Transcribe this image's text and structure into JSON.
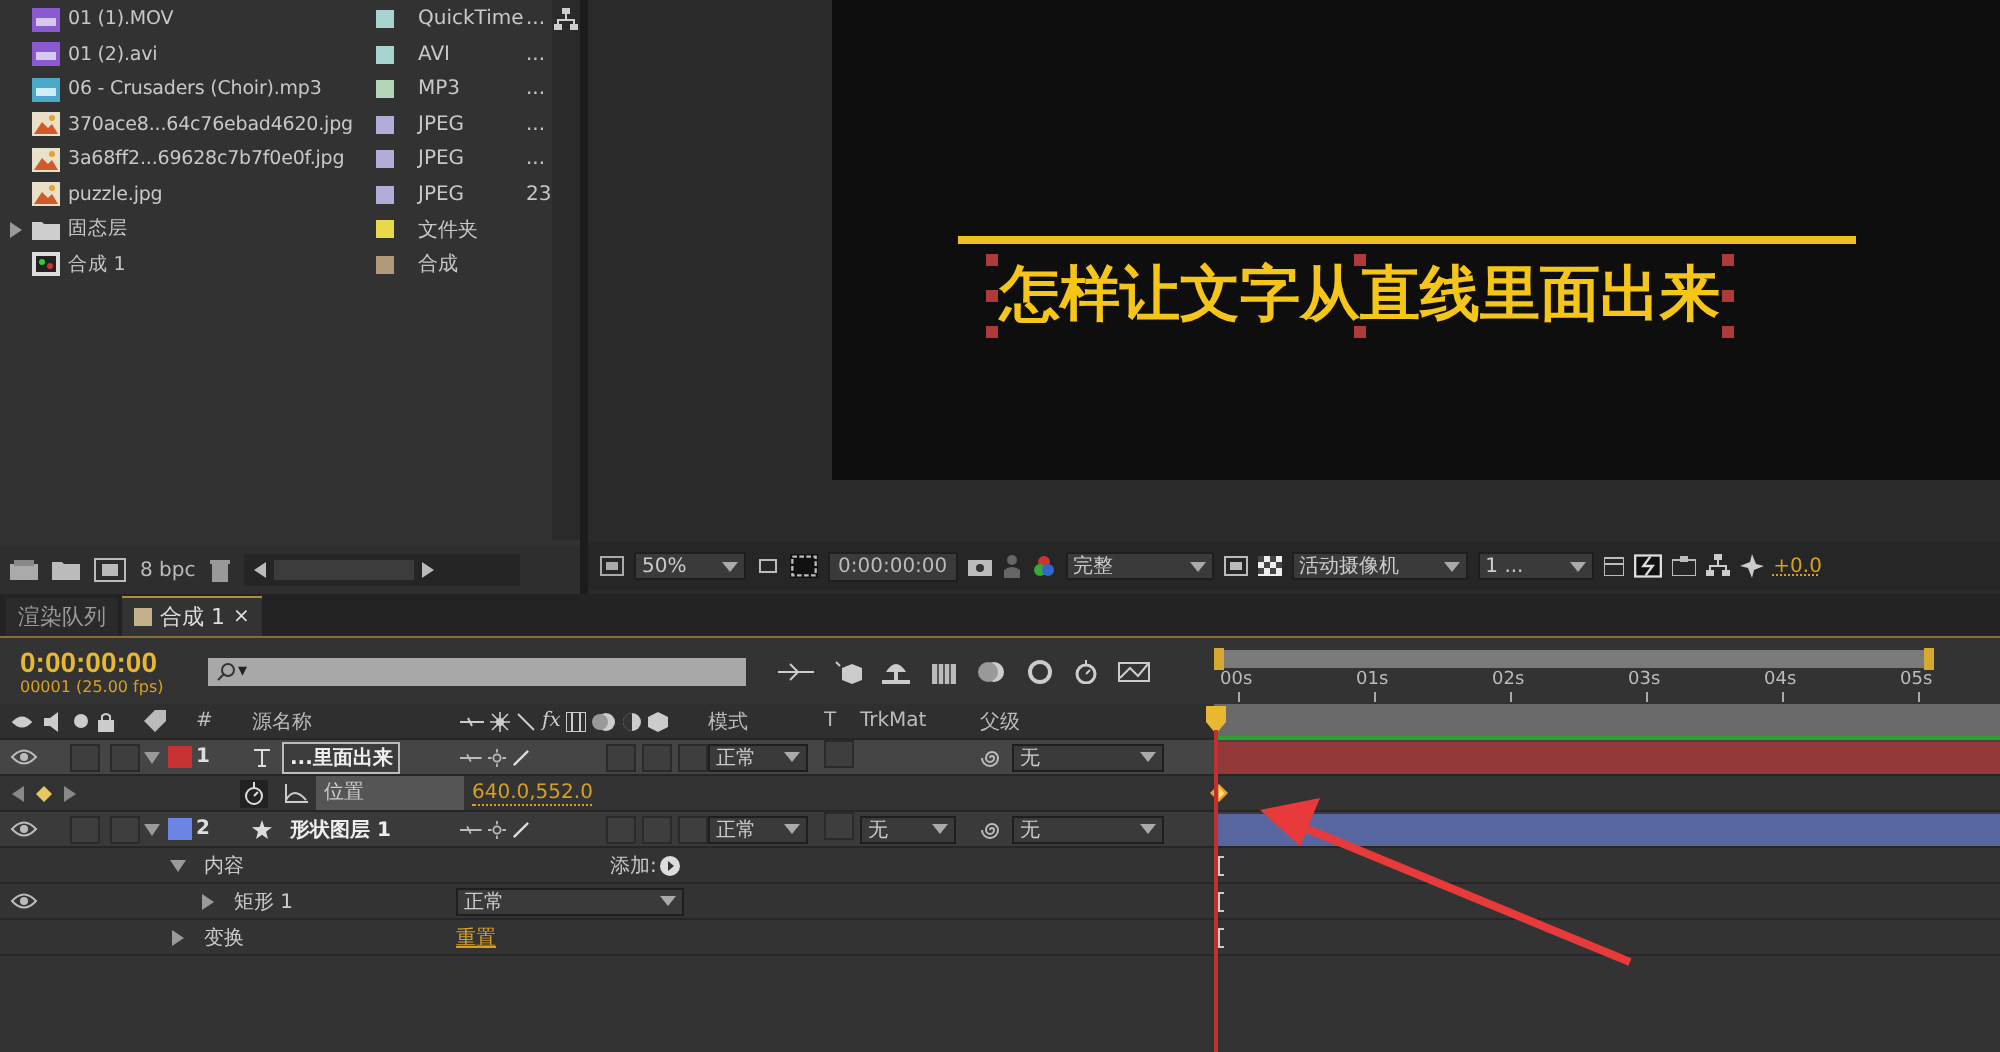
{
  "project": {
    "items": [
      {
        "name": "01 (1).MOV",
        "type": "QuickTime",
        "kind": "video",
        "color": "#a8d4d0",
        "col_4": "..."
      },
      {
        "name": "01 (2).avi",
        "type": "AVI",
        "kind": "video",
        "color": "#a8d4d0",
        "col_4": "..."
      },
      {
        "name": "06 - Crusaders (Choir).mp3",
        "type": "MP3",
        "kind": "audio",
        "color": "#b4d4b8",
        "col_4": "..."
      },
      {
        "name": "370ace8...64c76ebad4620.jpg",
        "type": "JPEG",
        "kind": "image",
        "color": "#b0aed8",
        "col_4": "..."
      },
      {
        "name": "3a68ff2...69628c7b7f0e0f.jpg",
        "type": "JPEG",
        "kind": "image",
        "color": "#b0aed8",
        "col_4": "..."
      },
      {
        "name": "puzzle.jpg",
        "type": "JPEG",
        "kind": "image",
        "color": "#b0aed8",
        "col_4": "23"
      },
      {
        "name": "固态层",
        "type": "文件夹",
        "kind": "folder",
        "color": "#e8d84a",
        "expanded": false
      },
      {
        "name": "合成 1",
        "type": "合成",
        "kind": "comp",
        "color": "#b09a7a"
      }
    ],
    "bit_depth": "8 bpc"
  },
  "viewer": {
    "text": "怎样让文字从直线里面出来",
    "text_selected": true,
    "zoom": "50%",
    "timecode": "0:00:00:00",
    "resolution": "完整",
    "camera": "活动摄像机",
    "views": "1 ...",
    "exposure": "+0.0"
  },
  "tabs": [
    {
      "label": "渲染队列",
      "selected": false
    },
    {
      "label": "合成 1",
      "selected": true,
      "close": "×"
    }
  ],
  "timeline": {
    "current_time": "0:00:00:00",
    "frame_info": "00001 (25.00 fps)",
    "search_prefix": "▾",
    "columns": {
      "effects": "fx",
      "number": "#",
      "source_name": "源名称",
      "mode": "模式",
      "t": "T",
      "trkmat": "TrkMat",
      "parent": "父级"
    },
    "ruler": [
      "00s",
      "01s",
      "02s",
      "03s",
      "04s",
      "05s"
    ],
    "layers": [
      {
        "kind": "text_layer",
        "number": "1",
        "name": "...里面出来",
        "color": "#c83232",
        "selected": true,
        "expanded": true,
        "visible": true,
        "mode": "正常",
        "parent": "无",
        "children": [
          {
            "kind": "property",
            "name": "位置",
            "value": "640.0,552.0",
            "selected": true,
            "keyframe": true
          }
        ]
      },
      {
        "kind": "shape_layer",
        "number": "2",
        "name": "形状图层 1",
        "color": "#6c84e4",
        "selected": false,
        "expanded": true,
        "visible": true,
        "mode": "正常",
        "trkmat": "无",
        "parent": "无",
        "children": [
          {
            "kind": "group",
            "name": "内容",
            "expanded": true,
            "add_label": "添加:",
            "children": [
              {
                "kind": "group",
                "name": "矩形 1",
                "expanded": false,
                "visible": true,
                "blend": "正常"
              }
            ]
          },
          {
            "kind": "group",
            "name": "变换",
            "expanded": false,
            "link": "重置"
          }
        ]
      }
    ]
  }
}
